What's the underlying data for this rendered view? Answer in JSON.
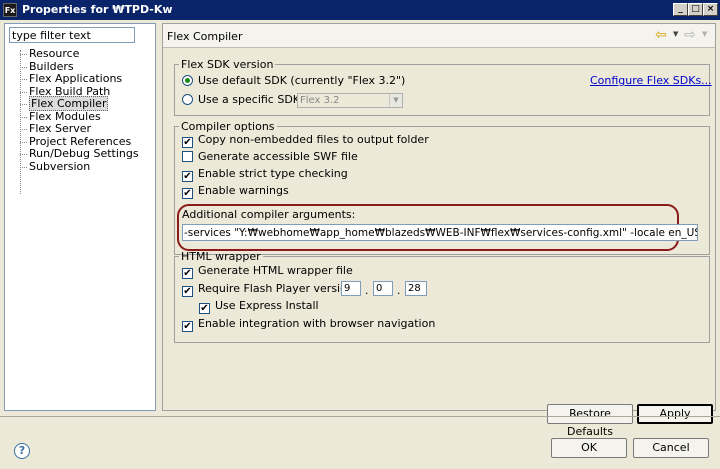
{
  "window": {
    "icon_text": "Fx",
    "title": "Properties for ₩TPD-Kw",
    "controls": [
      "_",
      "□",
      "×"
    ]
  },
  "filter": {
    "value": "type filter text"
  },
  "tree": {
    "items": [
      {
        "label": "Resource",
        "selected": false
      },
      {
        "label": "Builders",
        "selected": false
      },
      {
        "label": "Flex Applications",
        "selected": false
      },
      {
        "label": "Flex Build Path",
        "selected": false
      },
      {
        "label": "Flex Compiler",
        "selected": true
      },
      {
        "label": "Flex Modules",
        "selected": false
      },
      {
        "label": "Flex Server",
        "selected": false
      },
      {
        "label": "Project References",
        "selected": false
      },
      {
        "label": "Run/Debug Settings",
        "selected": false
      },
      {
        "label": "Subversion",
        "selected": false
      }
    ]
  },
  "page": {
    "title": "Flex Compiler",
    "nav": {
      "back_icon": "back-arrow-icon",
      "forward_icon": "forward-arrow-icon"
    }
  },
  "sdk": {
    "legend": "Flex SDK version",
    "default_label": "Use default SDK (currently \"Flex 3.2\")",
    "specific_label": "Use a specific SDK:",
    "specific_value": "Flex 3.2",
    "configure_link": "Configure Flex SDKs...",
    "selected": "default"
  },
  "compiler": {
    "legend": "Compiler options",
    "options": [
      {
        "label": "Copy non-embedded files to output folder",
        "checked": true
      },
      {
        "label": "Generate accessible SWF file",
        "checked": false
      },
      {
        "label": "Enable strict type checking",
        "checked": true
      },
      {
        "label": "Enable warnings",
        "checked": true
      }
    ],
    "args_label": "Additional compiler arguments:",
    "args_value": "-services \"Y:₩webhome₩app_home₩blazeds₩WEB-INF₩flex₩services-config.xml\" -locale en_US",
    "highlight_color": "#8b1a1a"
  },
  "wrapper": {
    "legend": "HTML wrapper",
    "generate_label": "Generate HTML wrapper file",
    "generate_checked": true,
    "require_label": "Require Flash Player version:",
    "require_checked": true,
    "version": {
      "major": "9",
      "minor": "0",
      "revision": "28"
    },
    "version_sep": ".",
    "express_label": "Use Express Install",
    "express_checked": true,
    "integration_label": "Enable integration with browser navigation",
    "integration_checked": true
  },
  "buttons": {
    "restore": "Restore Defaults",
    "apply": "Apply",
    "ok": "OK",
    "cancel": "Cancel"
  },
  "help": {
    "icon": "help-icon",
    "glyph": "?"
  },
  "checkmark": "✔"
}
